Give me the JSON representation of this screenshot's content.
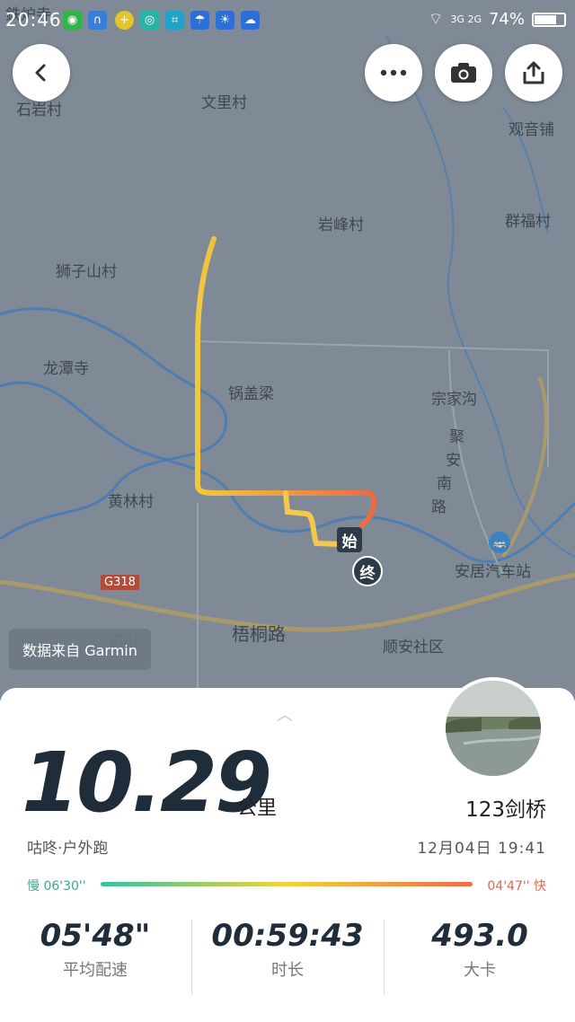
{
  "status_bar": {
    "time": "20:46",
    "network": "3G 2G",
    "battery": "74%",
    "battery_level": 0.74
  },
  "map": {
    "labels": [
      "鉄炉寺",
      "石岩村",
      "文里村",
      "观音铺",
      "岩峰村",
      "群福村",
      "狮子山村",
      "龙潭寺",
      "锅盖梁",
      "宗家沟",
      "聚",
      "安",
      "南",
      "路",
      "黄林村",
      "安居汽车站",
      "G318",
      "梧桐路",
      "顺安社区",
      "洞山"
    ],
    "start_marker": "始",
    "end_marker": "终",
    "attribution": "数据来自 Garmin"
  },
  "toolbar": {
    "back_icon": "back-chevron-icon",
    "more_icon": "more-dots-icon",
    "camera_icon": "camera-icon",
    "share_icon": "share-icon"
  },
  "summary": {
    "distance": "10.29",
    "distance_unit": "公里",
    "place": "123剑桥",
    "source": "咕咚·户外跑",
    "datetime": "12月04日 19:41",
    "pace_slow": "慢 06'30''",
    "pace_fast": "04'47'' 快"
  },
  "stats": [
    {
      "value": "05'48\"",
      "label": "平均配速"
    },
    {
      "value": "00:59:43",
      "label": "时长"
    },
    {
      "value": "493.0",
      "label": "大卡"
    }
  ]
}
